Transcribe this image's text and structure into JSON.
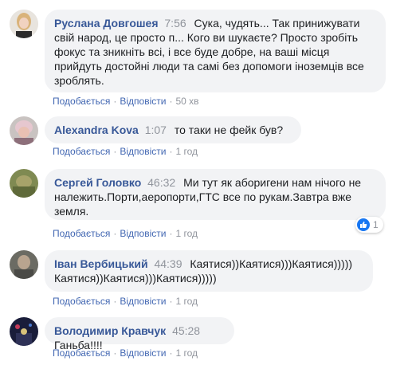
{
  "comments": [
    {
      "author": "Руслана Довгошея",
      "time": "7:56",
      "text": "Сука, чудять... Так принижувати свій народ, це просто п... Кого ви шукаєте? Просто зробіть фокус та зникніть всі, і все буде добре, на ваші місця прийдуть достойні люди та самі без допомоги іноземців все зроблять.",
      "like": "Подобається",
      "reply": "Відповісти",
      "age": "50 хв"
    },
    {
      "author": "Alexandra Kova",
      "time": "1:07",
      "text": "то таки не фейк був?",
      "like": "Подобається",
      "reply": "Відповісти",
      "age": "1 год"
    },
    {
      "author": "Сергей Головко",
      "time": "46:32",
      "text": "Ми тут як аборигени нам нічого не належить.Порти,аеропорти,ГТС все по рукам.Завтра вже земля.",
      "like": "Подобається",
      "reply": "Відповісти",
      "age": "1 год",
      "reaction_count": "1"
    },
    {
      "author": "Іван Вербицький",
      "time": "44:39",
      "text": "Каятися))Каятися)))Каятися))))) Каятися))Каятися)))Каятися)))))",
      "like": "Подобається",
      "reply": "Відповісти",
      "age": "1 год"
    },
    {
      "author": "Володимир Кравчук",
      "time": "45:28",
      "text": "Ганьба!!!!",
      "like": "Подобається",
      "reply": "Відповісти",
      "age": "1 год"
    }
  ],
  "colors": {
    "link": "#385898",
    "action_link": "#4267b2",
    "muted": "#90949c",
    "bubble_bg": "#f2f3f5",
    "like_blue": "#1877f2"
  },
  "icons": {
    "reaction": "thumbs-up-icon"
  }
}
